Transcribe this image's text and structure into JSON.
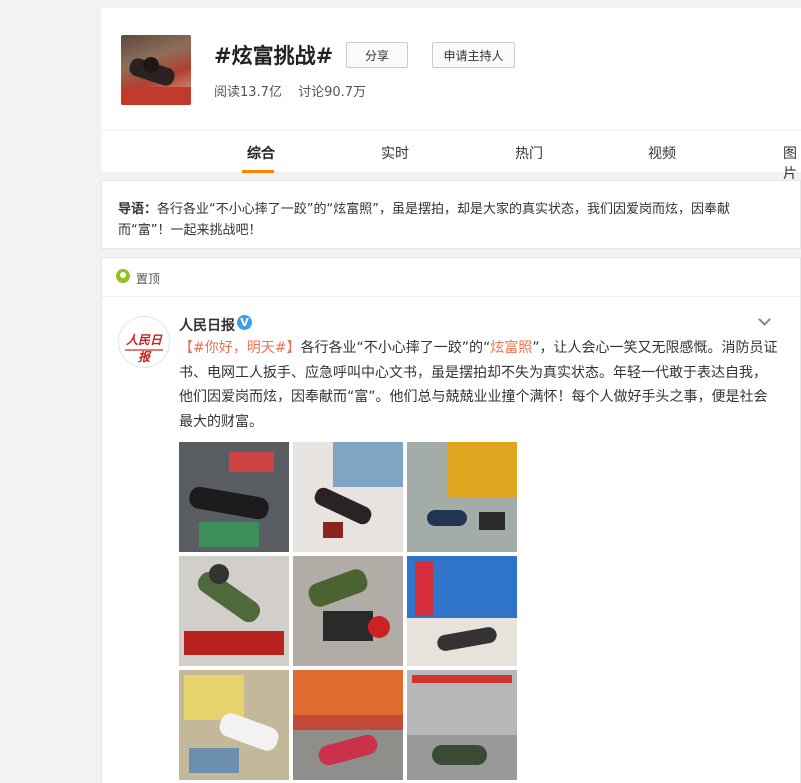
{
  "topic": {
    "title": "#炫富挑战#",
    "share_label": "分享",
    "host_label": "申请主持人",
    "reads": "阅读13.7亿",
    "discussions": "讨论90.7万"
  },
  "tabs": [
    "综合",
    "实时",
    "热门",
    "视频",
    "图片"
  ],
  "intro": {
    "label": "导语：",
    "text": "各行各业“不小心摔了一跤”的“炫富照”，虽是摆拍，却是大家的真实状态，我们因爱岗而炫，因奉献而“富”！一起来挑战吧！"
  },
  "pinned": {
    "label": "置顶"
  },
  "post": {
    "author": "人民日报",
    "avatar_text": "人民日报",
    "hashtag": "【#你好，明天#】",
    "text_1": "各行各业“不小心摔了一跤”的“",
    "highlight": "炫富照",
    "text_2": "”，让人会心一笑又无限感慨。消防员证书、电网工人扳手、应急呼叫中心文书，虽是摆拍却不失为真实状态。年轻一代敢于表达自我，他们因爱岗而炫，因奉献而“富”。他们总与兢兢业业撞个满怀！每个人做好手头之事，便是社会最大的财富。",
    "photos": [
      {
        "name": "photo-1",
        "bg": "#6b6f72"
      },
      {
        "name": "photo-2",
        "bg": "#d8d3cf"
      },
      {
        "name": "photo-3",
        "bg": "#9da7a5"
      },
      {
        "name": "photo-4",
        "bg": "#c9c6c2"
      },
      {
        "name": "photo-5",
        "bg": "#a9a49e"
      },
      {
        "name": "photo-6",
        "bg": "#8aa0b8"
      },
      {
        "name": "photo-7",
        "bg": "#b9a98f"
      },
      {
        "name": "photo-8",
        "bg": "#c24a3b"
      },
      {
        "name": "photo-9",
        "bg": "#7d7d80"
      }
    ]
  },
  "colors": {
    "accent": "#ff8200",
    "link": "#eb7350",
    "verified": "#3f9ce8"
  },
  "icons": {
    "pin": "location-pin-icon",
    "verified": "verified-v-icon",
    "menu": "chevron-down-icon"
  }
}
